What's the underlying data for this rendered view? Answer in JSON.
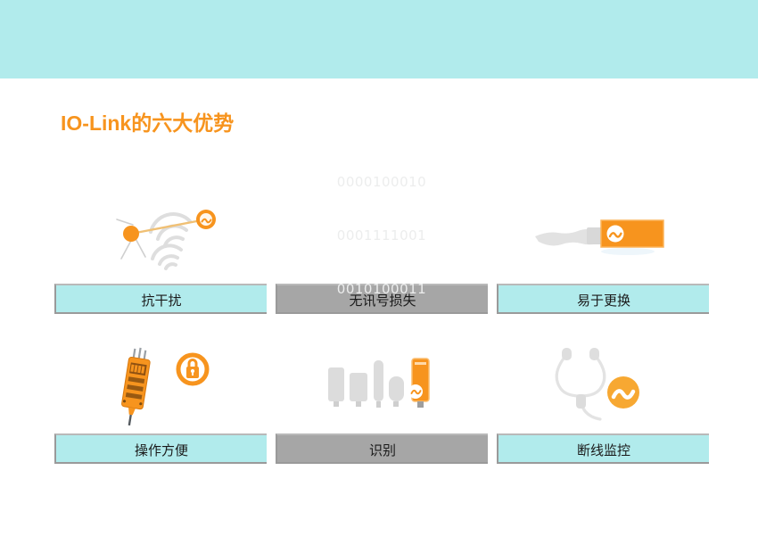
{
  "slide": {
    "title": "IO-Link的六大优势",
    "title_color": "#f7941e",
    "header_band_color": "#b1ebec",
    "background_color": "#ffffff"
  },
  "palette": {
    "cyan": "#b1ebec",
    "gray": "#a6a6a6",
    "orange": "#f7941e",
    "light_gray": "#d9d9d9",
    "binary_text": "#ececec"
  },
  "advantages": [
    {
      "label": "抗干扰",
      "bar_style": "cyan",
      "icon": "signal-interference-icon"
    },
    {
      "label": "无讯号损失",
      "bar_style": "gray",
      "icon": "binary-data-icon",
      "binary_lines": [
        "0000100010",
        "0001111001",
        "0010100011"
      ]
    },
    {
      "label": "易于更换",
      "bar_style": "cyan",
      "icon": "plug-connector-icon"
    },
    {
      "label": "操作方便",
      "bar_style": "cyan",
      "icon": "handheld-device-lock-icon"
    },
    {
      "label": "识别",
      "bar_style": "gray",
      "icon": "sensor-family-icon"
    },
    {
      "label": "断线监控",
      "bar_style": "cyan",
      "icon": "cable-monitoring-icon"
    }
  ]
}
